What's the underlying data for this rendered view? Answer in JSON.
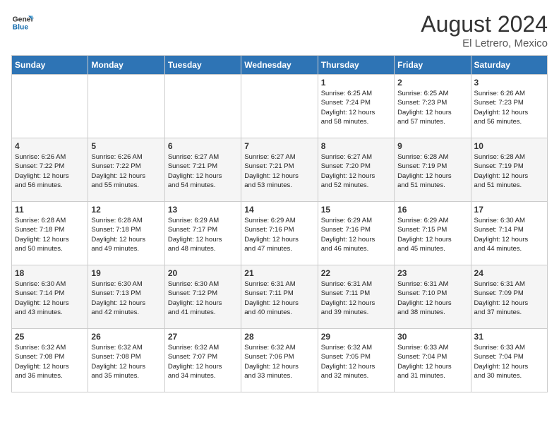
{
  "header": {
    "logo_general": "General",
    "logo_blue": "Blue",
    "month_year": "August 2024",
    "location": "El Letrero, Mexico"
  },
  "days_of_week": [
    "Sunday",
    "Monday",
    "Tuesday",
    "Wednesday",
    "Thursday",
    "Friday",
    "Saturday"
  ],
  "weeks": [
    [
      {
        "day": "",
        "detail": ""
      },
      {
        "day": "",
        "detail": ""
      },
      {
        "day": "",
        "detail": ""
      },
      {
        "day": "",
        "detail": ""
      },
      {
        "day": "1",
        "detail": "Sunrise: 6:25 AM\nSunset: 7:24 PM\nDaylight: 12 hours\nand 58 minutes."
      },
      {
        "day": "2",
        "detail": "Sunrise: 6:25 AM\nSunset: 7:23 PM\nDaylight: 12 hours\nand 57 minutes."
      },
      {
        "day": "3",
        "detail": "Sunrise: 6:26 AM\nSunset: 7:23 PM\nDaylight: 12 hours\nand 56 minutes."
      }
    ],
    [
      {
        "day": "4",
        "detail": "Sunrise: 6:26 AM\nSunset: 7:22 PM\nDaylight: 12 hours\nand 56 minutes."
      },
      {
        "day": "5",
        "detail": "Sunrise: 6:26 AM\nSunset: 7:22 PM\nDaylight: 12 hours\nand 55 minutes."
      },
      {
        "day": "6",
        "detail": "Sunrise: 6:27 AM\nSunset: 7:21 PM\nDaylight: 12 hours\nand 54 minutes."
      },
      {
        "day": "7",
        "detail": "Sunrise: 6:27 AM\nSunset: 7:21 PM\nDaylight: 12 hours\nand 53 minutes."
      },
      {
        "day": "8",
        "detail": "Sunrise: 6:27 AM\nSunset: 7:20 PM\nDaylight: 12 hours\nand 52 minutes."
      },
      {
        "day": "9",
        "detail": "Sunrise: 6:28 AM\nSunset: 7:19 PM\nDaylight: 12 hours\nand 51 minutes."
      },
      {
        "day": "10",
        "detail": "Sunrise: 6:28 AM\nSunset: 7:19 PM\nDaylight: 12 hours\nand 51 minutes."
      }
    ],
    [
      {
        "day": "11",
        "detail": "Sunrise: 6:28 AM\nSunset: 7:18 PM\nDaylight: 12 hours\nand 50 minutes."
      },
      {
        "day": "12",
        "detail": "Sunrise: 6:28 AM\nSunset: 7:18 PM\nDaylight: 12 hours\nand 49 minutes."
      },
      {
        "day": "13",
        "detail": "Sunrise: 6:29 AM\nSunset: 7:17 PM\nDaylight: 12 hours\nand 48 minutes."
      },
      {
        "day": "14",
        "detail": "Sunrise: 6:29 AM\nSunset: 7:16 PM\nDaylight: 12 hours\nand 47 minutes."
      },
      {
        "day": "15",
        "detail": "Sunrise: 6:29 AM\nSunset: 7:16 PM\nDaylight: 12 hours\nand 46 minutes."
      },
      {
        "day": "16",
        "detail": "Sunrise: 6:29 AM\nSunset: 7:15 PM\nDaylight: 12 hours\nand 45 minutes."
      },
      {
        "day": "17",
        "detail": "Sunrise: 6:30 AM\nSunset: 7:14 PM\nDaylight: 12 hours\nand 44 minutes."
      }
    ],
    [
      {
        "day": "18",
        "detail": "Sunrise: 6:30 AM\nSunset: 7:14 PM\nDaylight: 12 hours\nand 43 minutes."
      },
      {
        "day": "19",
        "detail": "Sunrise: 6:30 AM\nSunset: 7:13 PM\nDaylight: 12 hours\nand 42 minutes."
      },
      {
        "day": "20",
        "detail": "Sunrise: 6:30 AM\nSunset: 7:12 PM\nDaylight: 12 hours\nand 41 minutes."
      },
      {
        "day": "21",
        "detail": "Sunrise: 6:31 AM\nSunset: 7:11 PM\nDaylight: 12 hours\nand 40 minutes."
      },
      {
        "day": "22",
        "detail": "Sunrise: 6:31 AM\nSunset: 7:11 PM\nDaylight: 12 hours\nand 39 minutes."
      },
      {
        "day": "23",
        "detail": "Sunrise: 6:31 AM\nSunset: 7:10 PM\nDaylight: 12 hours\nand 38 minutes."
      },
      {
        "day": "24",
        "detail": "Sunrise: 6:31 AM\nSunset: 7:09 PM\nDaylight: 12 hours\nand 37 minutes."
      }
    ],
    [
      {
        "day": "25",
        "detail": "Sunrise: 6:32 AM\nSunset: 7:08 PM\nDaylight: 12 hours\nand 36 minutes."
      },
      {
        "day": "26",
        "detail": "Sunrise: 6:32 AM\nSunset: 7:08 PM\nDaylight: 12 hours\nand 35 minutes."
      },
      {
        "day": "27",
        "detail": "Sunrise: 6:32 AM\nSunset: 7:07 PM\nDaylight: 12 hours\nand 34 minutes."
      },
      {
        "day": "28",
        "detail": "Sunrise: 6:32 AM\nSunset: 7:06 PM\nDaylight: 12 hours\nand 33 minutes."
      },
      {
        "day": "29",
        "detail": "Sunrise: 6:32 AM\nSunset: 7:05 PM\nDaylight: 12 hours\nand 32 minutes."
      },
      {
        "day": "30",
        "detail": "Sunrise: 6:33 AM\nSunset: 7:04 PM\nDaylight: 12 hours\nand 31 minutes."
      },
      {
        "day": "31",
        "detail": "Sunrise: 6:33 AM\nSunset: 7:04 PM\nDaylight: 12 hours\nand 30 minutes."
      }
    ]
  ]
}
